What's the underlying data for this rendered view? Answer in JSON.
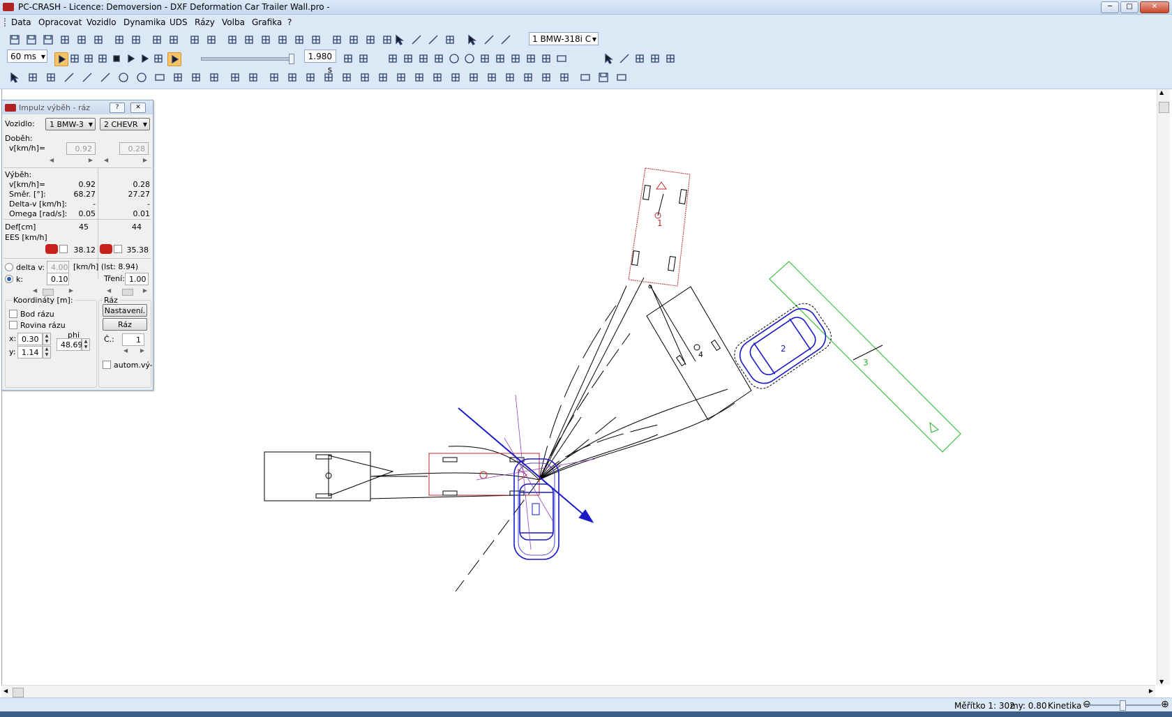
{
  "window": {
    "title": "PC-CRASH - Licence: Demoversion - DXF Deformation Car Trailer Wall.pro -",
    "controls": {
      "minimize": "─",
      "maximize": "□",
      "close": "✕"
    }
  },
  "menu": [
    "Data",
    "Opracovat",
    "Vozidlo",
    "Dynamika",
    "UDS",
    "Rázy",
    "Volba",
    "Grafika",
    "?"
  ],
  "toolbar": {
    "vehicle_select": "1  BMW-318i C",
    "time_step": "60 ms",
    "time_value": "1.980 s",
    "row1_icons": [
      "save-icon",
      "save-as-icon",
      "save-all-icon",
      "car-icon",
      "car-export-icon",
      "car-import-icon",
      "print-preview-icon",
      "print-icon",
      "copy-icon",
      "paste-icon",
      "undo-icon",
      "redo-icon",
      "zoom-in-icon",
      "zoom-out-icon",
      "grid-icon",
      "hand-pan-icon",
      "fit-icon",
      "measure-icon",
      "layers-icon",
      "camera-icon",
      "ruler-icon",
      "help-icon"
    ],
    "row1_right_icons": [
      "select-vehicle-icon",
      "path-icon",
      "path-edit-icon",
      "marker-icon",
      "select-arrow-icon",
      "polyline-icon",
      "path-hand-icon"
    ],
    "row2_icons": [
      "record-back-icon",
      "skip-start-icon",
      "fast-back-icon",
      "step-back-icon",
      "stop-icon",
      "play-icon",
      "fast-forward-icon",
      "skip-end-icon",
      "record-forward-icon"
    ],
    "row2_right_icons": [
      "traffic-light-icon",
      "sequence-icon",
      "bmp-icon",
      "dxf-icon",
      "align-icon",
      "group-icon",
      "contrast-icon",
      "sun-icon",
      "light-icon",
      "gear-icon",
      "export-up-icon",
      "export-down-icon",
      "triangle-icon",
      "screen-icon"
    ],
    "row2_far_icons": [
      "cursor-star-icon",
      "path-icon",
      "wand-icon",
      "pen-icon",
      "brush-icon"
    ],
    "row3_icons": [
      "pointer-icon",
      "rotate-icon",
      "move-icon",
      "line-icon",
      "polyline-icon",
      "curve-icon",
      "arc-icon",
      "circle-icon",
      "rectangle-icon",
      "text-abc-icon",
      "dimension-icon",
      "cross-icon",
      "copy-layer-icon",
      "group-layer-icon",
      "node-icon",
      "node-edit-icon",
      "duplicate-icon",
      "delete-icon",
      "scale-icon",
      "transform-icon",
      "3d-move-icon",
      "3d-rotate-icon",
      "paint-icon",
      "erase-icon",
      "hatch-icon",
      "layers-stack-icon",
      "signature-icon",
      "font-icon",
      "texture-icon",
      "color-icon",
      "bulb-icon",
      "open-folder-icon",
      "save-file-icon",
      "book-icon"
    ]
  },
  "dialog": {
    "title": "Impulz výběh - ráz",
    "help": "?",
    "close": "✕",
    "vozidlo_label": "Vozidlo:",
    "vehicle1": "1  BMW-3",
    "vehicle2": "2  CHEVR",
    "dobeh_label": "Doběh:",
    "v_label": "v[km/h]=",
    "v1_dobeh": "0.92",
    "v2_dobeh": "0.28",
    "vybeh_label": "Výběh:",
    "rows": [
      {
        "label": "v[km/h]=",
        "v1": "0.92",
        "v2": "0.28"
      },
      {
        "label": "Směr. [°]:",
        "v1": "68.27",
        "v2": "27.27"
      },
      {
        "label": "Delta-v [km/h]:",
        "v1": "-",
        "v2": "-"
      },
      {
        "label": "Omega [rad/s]:",
        "v1": "0.05",
        "v2": "0.01"
      }
    ],
    "def_label": "Def[cm]",
    "def1": "45",
    "def2": "44",
    "ees_label": "EES [km/h]",
    "ees1": "38.12",
    "ees2": "35.38",
    "deltav_radio": "delta v:",
    "deltav_value": "4.00",
    "deltav_unit": "[km/h] (lst: 8.94)",
    "k_radio": "k:",
    "k_value": "0.10",
    "treni_label": "Tření:",
    "treni_value": "1.00",
    "coords_group": "Koordináty [m]:",
    "bod_razu": "Bod rázu",
    "rovina_razu": "Rovina rázu",
    "x_label": "x:",
    "x_value": "0.30",
    "y_label": "y:",
    "y_value": "1.14",
    "phi_label": "phi",
    "phi_value": "48.69",
    "raz_group": "Ráz",
    "nastaveni_button": "Nastavení.",
    "raz_button": "Ráz",
    "c_label": "Č.:",
    "c_value": "1",
    "autom_label": "autom.vý-"
  },
  "canvas": {
    "labels": {
      "trailer_num": "1",
      "wall_num": "3",
      "car2_num": "2",
      "box_num": "4"
    },
    "colors": {
      "car1": "#1a1ac8",
      "trailer": "#c0282a",
      "wall": "#22b822",
      "lines": "#000000",
      "purple": "#9040c0"
    }
  },
  "status": {
    "scale": "Měřítko 1: 302",
    "my": "my: 0.80",
    "mode": "Kinetika",
    "zoom_out": "⊖",
    "zoom_in": "⊕"
  }
}
